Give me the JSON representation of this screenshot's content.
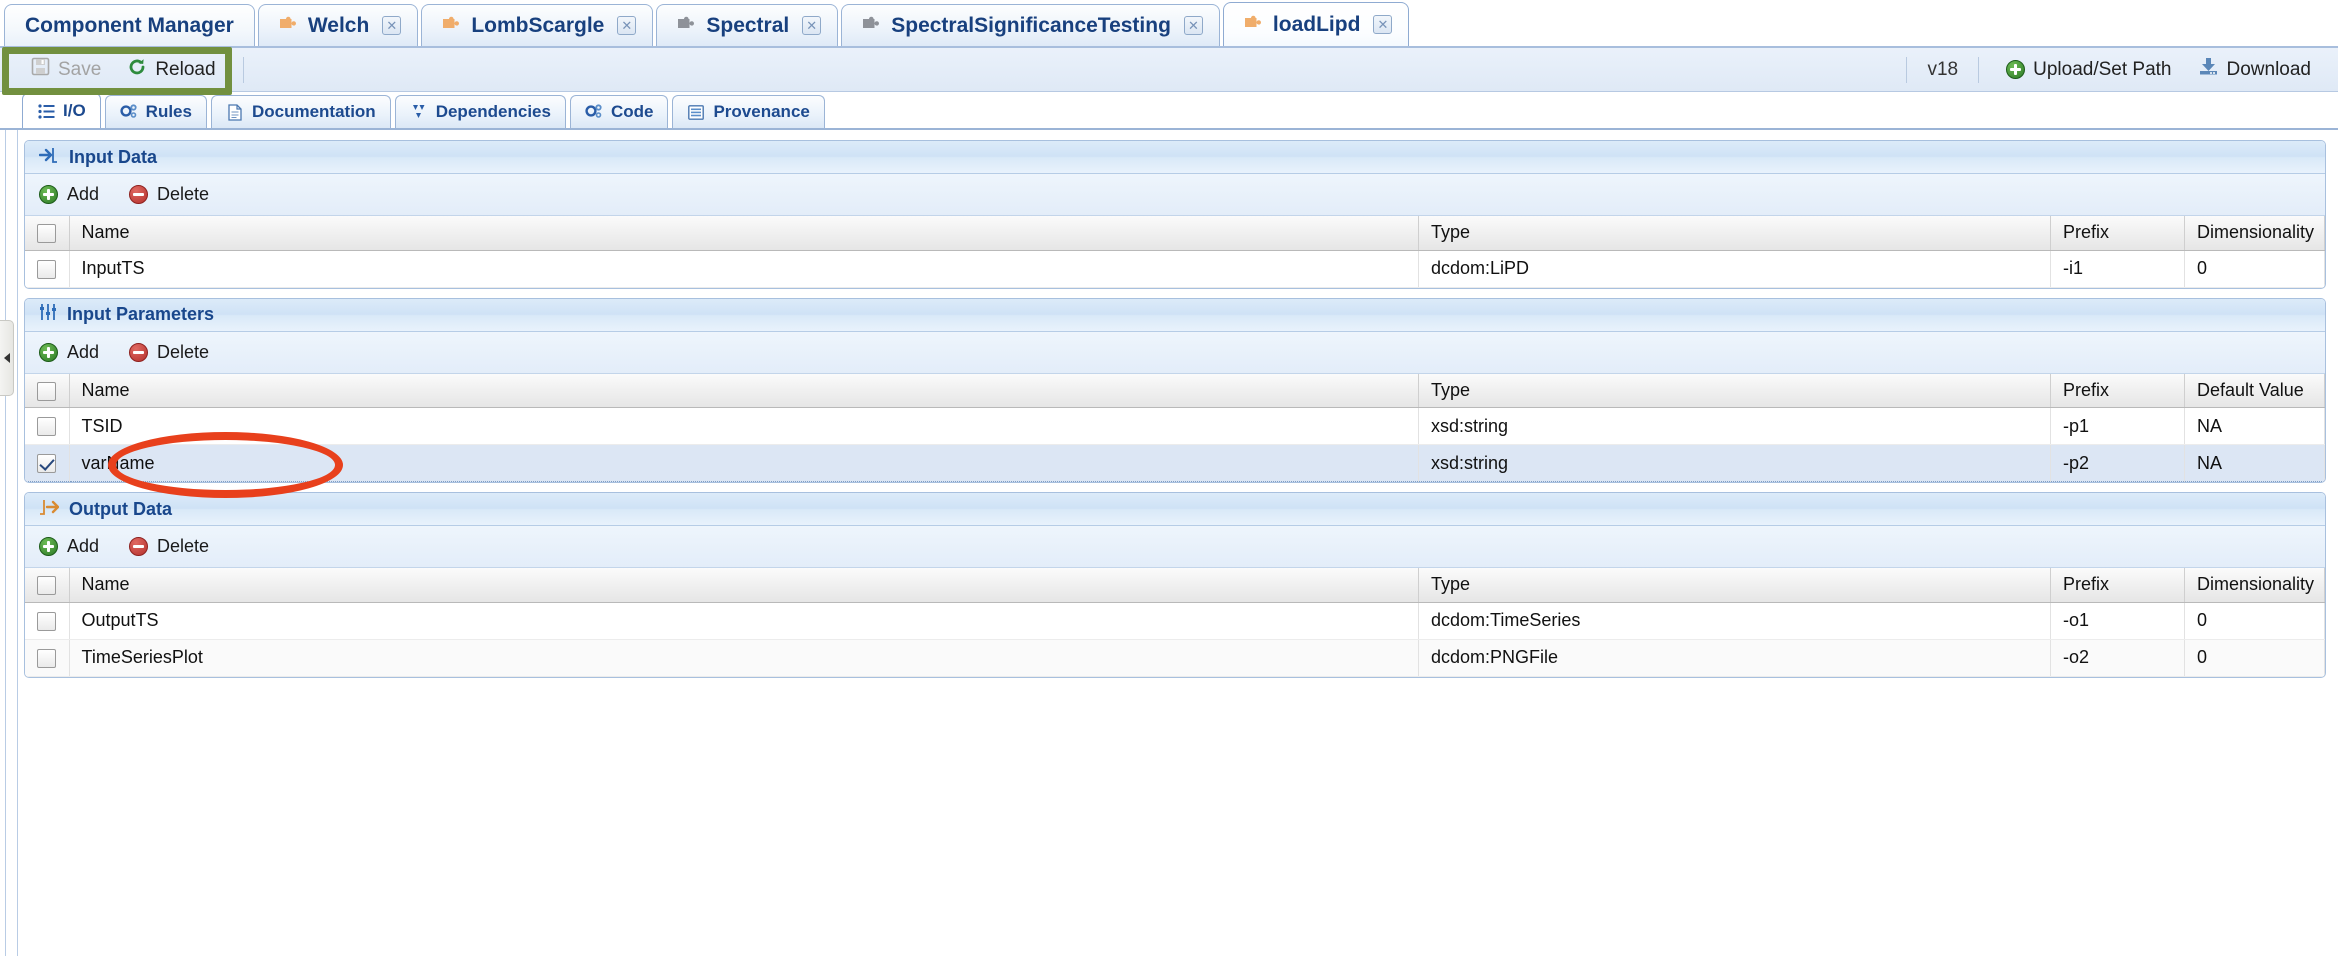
{
  "window": {
    "top_tabs": [
      {
        "label": "Component Manager",
        "icon": null,
        "closable": false,
        "active": false
      },
      {
        "label": "Welch",
        "icon": "puzzle-icon",
        "closable": true,
        "active": false
      },
      {
        "label": "LombScargle",
        "icon": "puzzle-icon",
        "closable": true,
        "active": false
      },
      {
        "label": "Spectral",
        "icon": "puzzle-icon",
        "closable": true,
        "active": false
      },
      {
        "label": "SpectralSignificanceTesting",
        "icon": "puzzle-icon",
        "closable": true,
        "active": false
      },
      {
        "label": "loadLipd",
        "icon": "puzzle-icon",
        "closable": true,
        "active": true
      }
    ],
    "close_glyph": "✕"
  },
  "toolbar": {
    "save_label": "Save",
    "save_icon": "floppy-disk-icon",
    "reload_label": "Reload",
    "reload_icon": "refresh-icon",
    "version_label": "v18",
    "upload_label": "Upload/Set Path",
    "upload_icon": "plus-circle-icon",
    "download_label": "Download",
    "download_icon": "download-icon"
  },
  "subtabs": [
    {
      "label": "I/O",
      "icon": "list-icon",
      "active": true
    },
    {
      "label": "Rules",
      "icon": "gears-icon",
      "active": false
    },
    {
      "label": "Documentation",
      "icon": "document-icon",
      "active": false
    },
    {
      "label": "Dependencies",
      "icon": "dependencies-icon",
      "active": false
    },
    {
      "label": "Code",
      "icon": "gears-icon",
      "active": false
    },
    {
      "label": "Provenance",
      "icon": "provenance-icon",
      "active": false
    }
  ],
  "sections": [
    {
      "id": "input-data",
      "title": "Input Data",
      "title_icon": "arrow-into-icon",
      "add_label": "Add",
      "delete_label": "Delete",
      "columns": [
        "Name",
        "Type",
        "Prefix",
        "Dimensionality"
      ],
      "rows": [
        {
          "checked": false,
          "selected": false,
          "name": "InputTS",
          "type": "dcdom:LiPD",
          "prefix": "-i1",
          "last": "0"
        }
      ]
    },
    {
      "id": "input-parameters",
      "title": "Input Parameters",
      "title_icon": "sliders-icon",
      "add_label": "Add",
      "delete_label": "Delete",
      "columns": [
        "Name",
        "Type",
        "Prefix",
        "Default Value"
      ],
      "rows": [
        {
          "checked": false,
          "selected": false,
          "name": "TSID",
          "type": "xsd:string",
          "prefix": "-p1",
          "last": "NA"
        },
        {
          "checked": true,
          "selected": true,
          "name": "varName",
          "type": "xsd:string",
          "prefix": "-p2",
          "last": "NA"
        }
      ]
    },
    {
      "id": "output-data",
      "title": "Output Data",
      "title_icon": "arrow-out-icon",
      "add_label": "Add",
      "delete_label": "Delete",
      "columns": [
        "Name",
        "Type",
        "Prefix",
        "Dimensionality"
      ],
      "rows": [
        {
          "checked": false,
          "selected": false,
          "name": "OutputTS",
          "type": "dcdom:TimeSeries",
          "prefix": "-o1",
          "last": "0"
        },
        {
          "checked": false,
          "selected": false,
          "name": "TimeSeriesPlot",
          "type": "dcdom:PNGFile",
          "prefix": "-o2",
          "last": "0"
        }
      ]
    }
  ],
  "annotations": {
    "highlight_rect_color": "#72903f",
    "highlight_ellipse_color": "#e8401c"
  }
}
